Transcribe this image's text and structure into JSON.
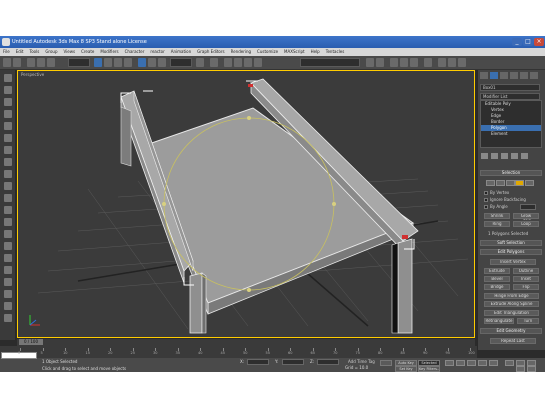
{
  "window": {
    "title": "Untitled    Autodesk 3ds Max 8 SP3    Stand alone License"
  },
  "menu": {
    "items": [
      "File",
      "Edit",
      "Tools",
      "Group",
      "Views",
      "Create",
      "Modifiers",
      "Character",
      "reactor",
      "Animation",
      "Graph Editors",
      "Rendering",
      "Customize",
      "MAXScript",
      "Help",
      "Tentacles"
    ]
  },
  "toolbar": {
    "selection_filter": "All",
    "reference_coord": "View"
  },
  "viewport": {
    "label": "Perspective"
  },
  "command_panel": {
    "object_name": "Box01",
    "modifier_list": "Modifier List",
    "stack_items": [
      "Editable Poly",
      "Vertex",
      "Edge",
      "Border",
      "Polygon",
      "Element"
    ],
    "selected_stack_item": "Polygon",
    "rollout_selection": "Selection",
    "by_vertex": "By Vertex",
    "ignore_backfacing": "Ignore Backfacing",
    "by_angle": "By Angle",
    "angle_value": "45.0",
    "shrink": "Shrink",
    "grow": "Grow",
    "ring": "Ring",
    "loop": "Loop",
    "selected_count": "1 Polygons Selected",
    "soft_selection": "Soft Selection",
    "edit_polygons": "Edit Polygons",
    "insert_vertex": "Insert Vertex",
    "extrude": "Extrude",
    "outline": "Outline",
    "bevel": "Bevel",
    "inset": "Inset",
    "bridge": "Bridge",
    "flip": "Flip",
    "hinge_from_edge": "Hinge From Edge",
    "extrude_along_spline": "Extrude Along Spline",
    "edit_triangulation": "Edit Triangulation",
    "retriangulate": "Retriangulate",
    "turn": "Turn",
    "edit_geometry": "Edit Geometry",
    "repeat_last": "Repeat Last"
  },
  "timeline": {
    "frame_display": "0 / 100",
    "ticks": [
      "0",
      "5",
      "10",
      "15",
      "20",
      "25",
      "30",
      "35",
      "40",
      "45",
      "50",
      "55",
      "60",
      "65",
      "70",
      "75",
      "80",
      "85",
      "90",
      "95",
      "100"
    ]
  },
  "status": {
    "selection": "1 Object Selected",
    "prompt": "Click and drag to select and move objects",
    "x_label": "X:",
    "y_label": "Y:",
    "z_label": "Z:",
    "auto_key": "Auto Key",
    "selected": "Selected",
    "set_key": "Set Key",
    "key_filters": "Key Filters...",
    "add_time_tag": "Add Time Tag",
    "grid": "Grid = 10.0"
  },
  "colors": {
    "viewport_bg": "#3b3b3b",
    "active_border": "#ffcc00",
    "selection_blue": "#3a6fb0",
    "gizmo_circle": "#c8c060"
  }
}
